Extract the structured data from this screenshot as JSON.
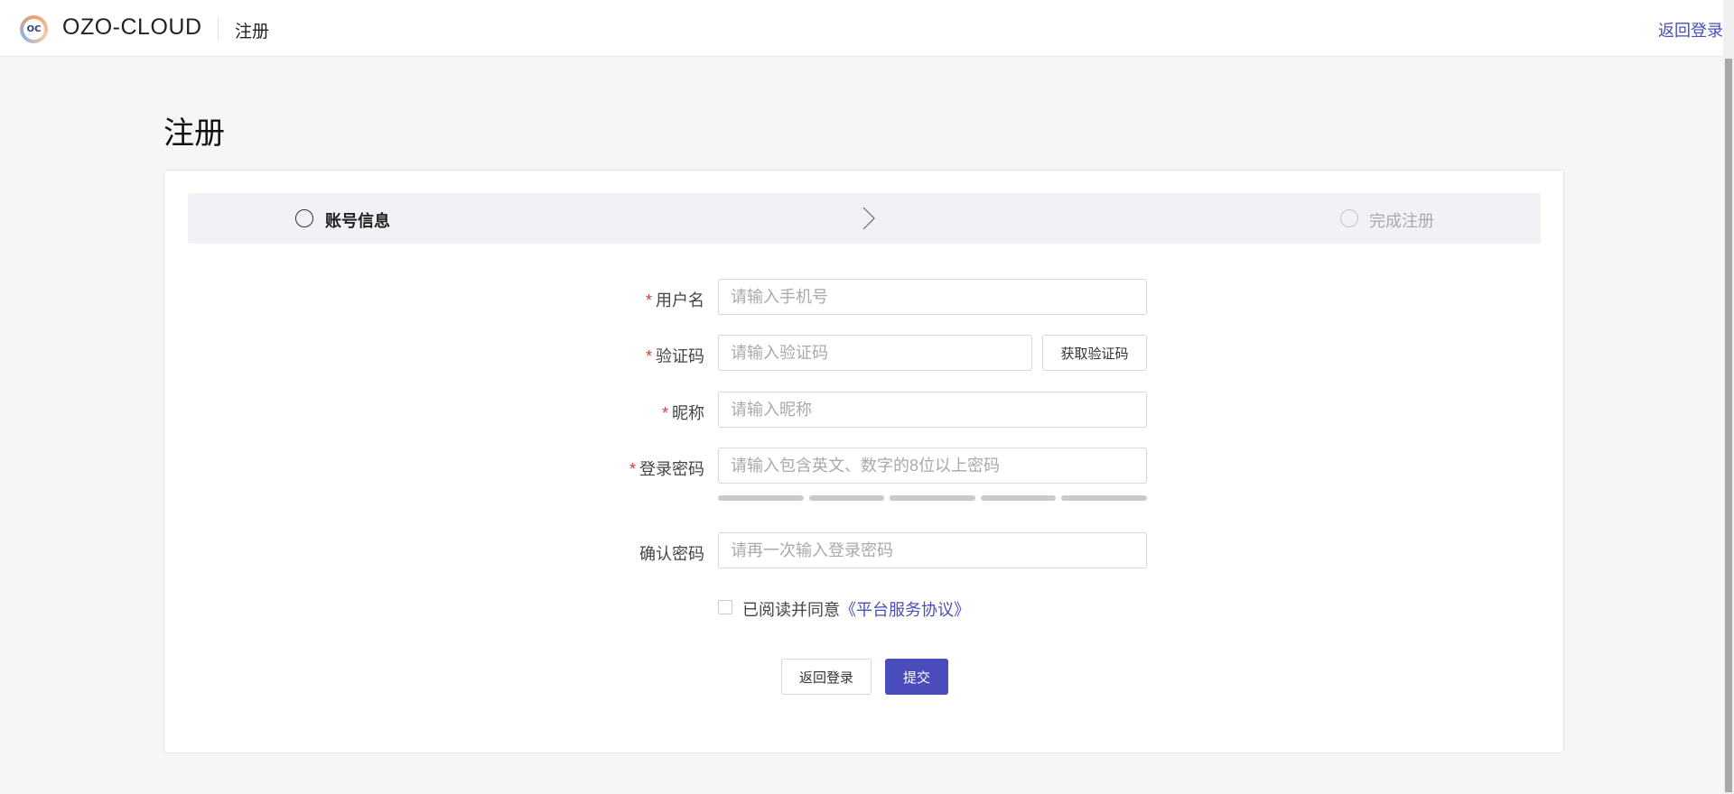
{
  "header": {
    "logo_text": "OC",
    "brand": "OZO-CLOUD",
    "title": "注册",
    "back_link": "返回登录"
  },
  "page": {
    "title": "注册"
  },
  "steps": [
    {
      "label": "账号信息",
      "state": "active"
    },
    {
      "label": "完成注册",
      "state": "pending"
    }
  ],
  "form": {
    "required_mark": "*",
    "username": {
      "label": "用户名",
      "placeholder": "请输入手机号",
      "value": ""
    },
    "code": {
      "label": "验证码",
      "placeholder": "请输入验证码",
      "value": "",
      "button": "获取验证码"
    },
    "nickname": {
      "label": "昵称",
      "placeholder": "请输入昵称",
      "value": ""
    },
    "password": {
      "label": "登录密码",
      "placeholder": "请输入包含英文、数字的8位以上密码",
      "value": "",
      "strength_segments": 5,
      "strength_level": 0
    },
    "confirm": {
      "label": "确认密码",
      "placeholder": "请再一次输入登录密码",
      "value": ""
    },
    "agreement": {
      "text": "已阅读并同意",
      "link": "《平台服务协议》",
      "checked": false
    }
  },
  "actions": {
    "back": "返回登录",
    "submit": "提交"
  },
  "colors": {
    "accent": "#4a4dbb",
    "required": "#e0393e",
    "background": "#f5f6f8"
  }
}
